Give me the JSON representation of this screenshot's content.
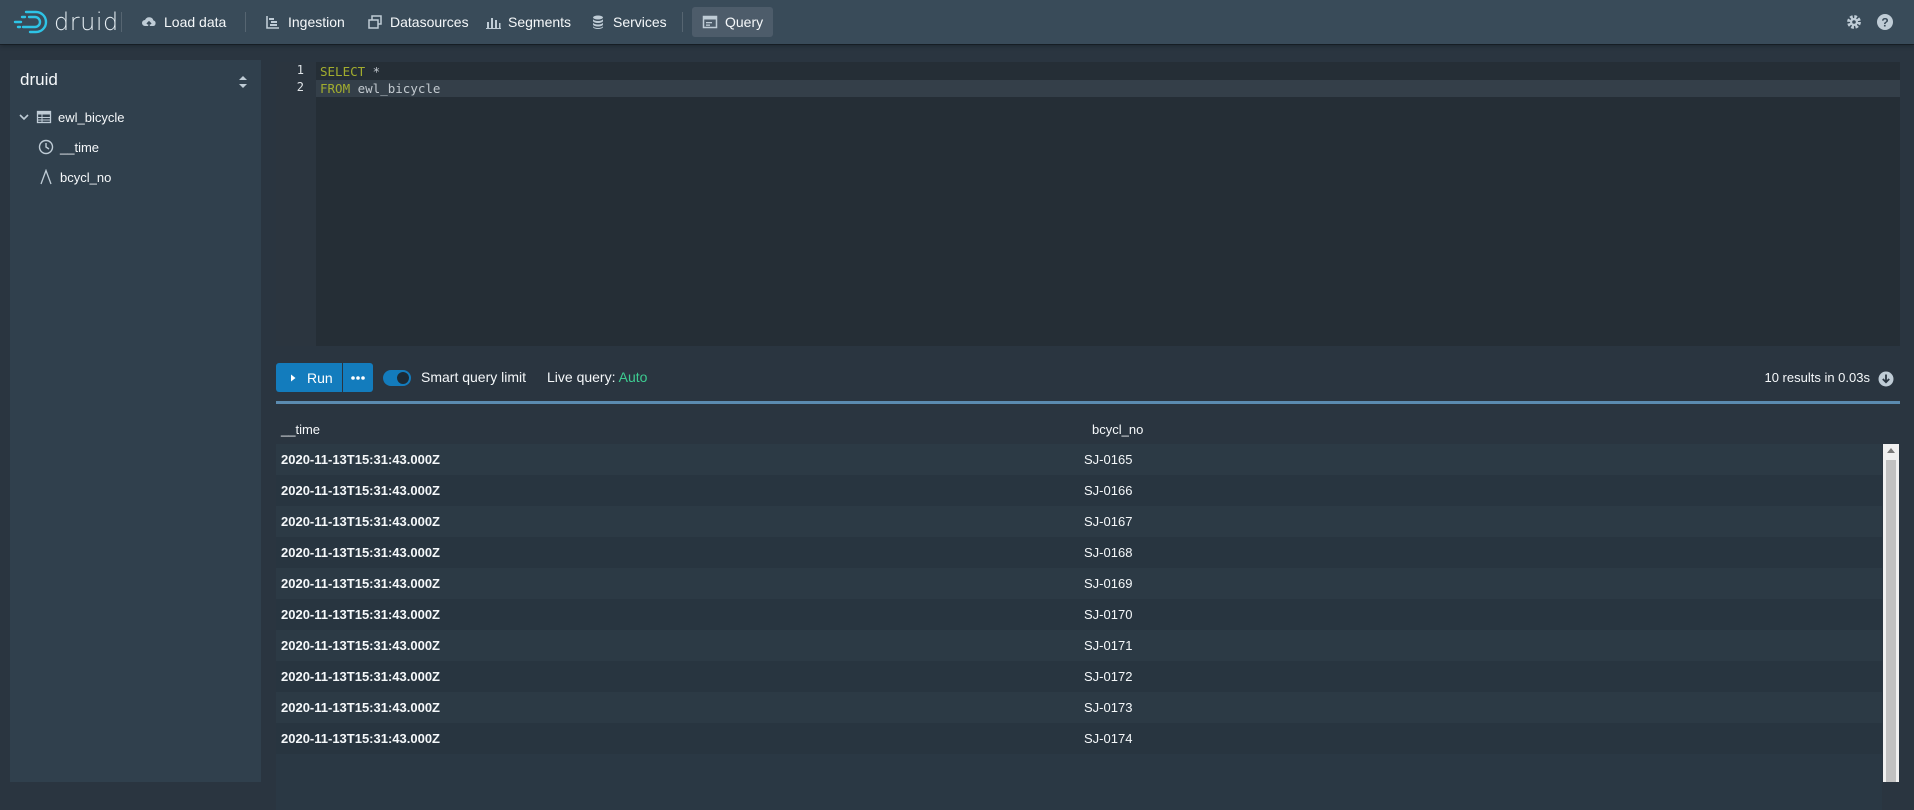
{
  "navbar": {
    "logo_text": "druid",
    "items": [
      {
        "label": "Load data",
        "icon": "cloud-upload-icon"
      },
      {
        "label": "Ingestion",
        "icon": "gantt-chart-icon"
      },
      {
        "label": "Datasources",
        "icon": "multi-select-icon"
      },
      {
        "label": "Segments",
        "icon": "stacked-chart-icon"
      },
      {
        "label": "Services",
        "icon": "database-icon"
      },
      {
        "label": "Query",
        "icon": "application-icon"
      }
    ],
    "active": "Query",
    "right_icons": [
      "gear-icon",
      "help-icon"
    ]
  },
  "sidebar": {
    "schema": "druid",
    "tree": [
      {
        "label": "ewl_bicycle",
        "icon": "table-icon",
        "expanded": true
      },
      {
        "label": "__time",
        "icon": "time-icon"
      },
      {
        "label": "bcycl_no",
        "icon": "string-column-icon"
      }
    ]
  },
  "editor": {
    "lines": [
      {
        "num": "1",
        "keyword": "SELECT",
        "rest": " *"
      },
      {
        "num": "2",
        "keyword": "FROM",
        "rest": " ewl_bicycle"
      }
    ]
  },
  "controls": {
    "run_label": "Run",
    "smart_query_limit_label": "Smart query limit",
    "smart_query_limit_on": true,
    "live_query_label": "Live query:",
    "live_query_value": "Auto",
    "results_info": "10 results in 0.03s"
  },
  "table": {
    "columns": [
      "__time",
      "bcycl_no"
    ],
    "rows": [
      [
        "2020-11-13T15:31:43.000Z",
        "SJ-0165"
      ],
      [
        "2020-11-13T15:31:43.000Z",
        "SJ-0166"
      ],
      [
        "2020-11-13T15:31:43.000Z",
        "SJ-0167"
      ],
      [
        "2020-11-13T15:31:43.000Z",
        "SJ-0168"
      ],
      [
        "2020-11-13T15:31:43.000Z",
        "SJ-0169"
      ],
      [
        "2020-11-13T15:31:43.000Z",
        "SJ-0170"
      ],
      [
        "2020-11-13T15:31:43.000Z",
        "SJ-0171"
      ],
      [
        "2020-11-13T15:31:43.000Z",
        "SJ-0172"
      ],
      [
        "2020-11-13T15:31:43.000Z",
        "SJ-0173"
      ],
      [
        "2020-11-13T15:31:43.000Z",
        "SJ-0174"
      ]
    ]
  },
  "colors": {
    "navbar_bg": "#394b59",
    "page_bg": "#2a3540",
    "accent": "#137cbd",
    "live_green": "#3dcc91",
    "keyword": "#a2ad2e"
  }
}
